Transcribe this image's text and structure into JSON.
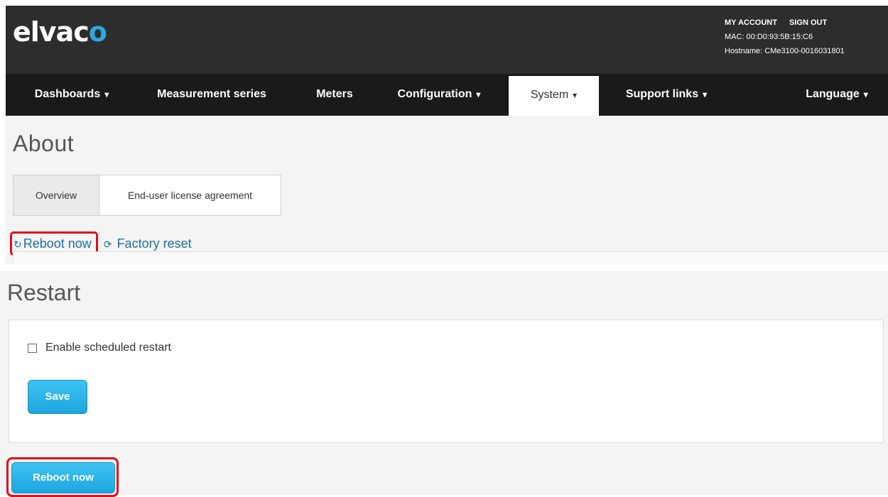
{
  "header": {
    "logo_main": "elvac",
    "logo_accent": "o",
    "my_account": "MY ACCOUNT",
    "sign_out": "SIGN OUT",
    "mac": "MAC: 00:D0:93:5B:15:C6",
    "hostname": "Hostname: CMe3100-0016031801",
    "accent_color": "#29a9e1"
  },
  "nav": {
    "dashboards": "Dashboards",
    "measurement_series": "Measurement series",
    "meters": "Meters",
    "configuration": "Configuration",
    "system": "System",
    "support_links": "Support links",
    "language": "Language",
    "caret": "⌄"
  },
  "about": {
    "title": "About",
    "tabs": [
      "Overview",
      "End-user license agreement"
    ],
    "reboot_link": "Reboot now",
    "factory_link": "Factory reset"
  },
  "restart": {
    "title": "Restart",
    "checkbox_label": "Enable scheduled restart",
    "checkbox_checked": false,
    "save_label": "Save",
    "reboot_label": "Reboot now",
    "button_color": "#1ea6df",
    "highlight_color": "#e0101e"
  }
}
